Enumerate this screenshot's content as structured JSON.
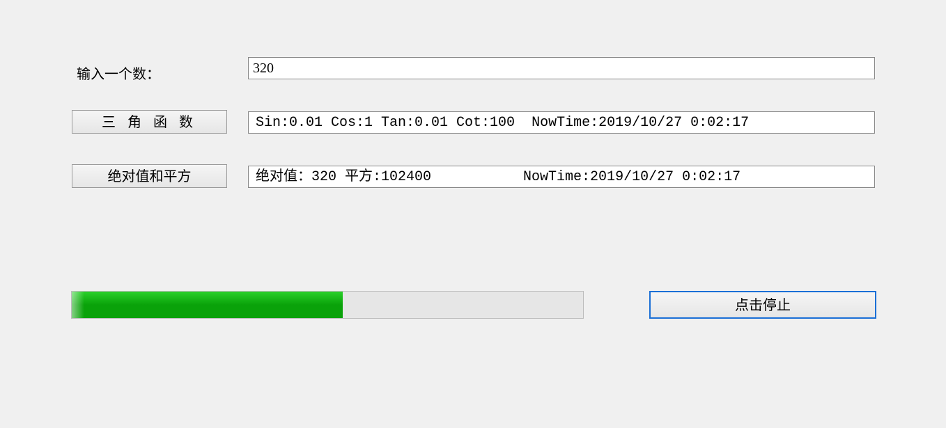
{
  "labels": {
    "input_number": "输入一个数：",
    "trig_button": "三 角 函 数",
    "abs_button": "绝对值和平方",
    "stop_button": "点击停止"
  },
  "values": {
    "input_number": "320",
    "trig_output": "Sin:0.01 Cos:1 Tan:0.01 Cot:100  NowTime:2019/10/27 0:02:17",
    "abs_output": "绝对值：320 平方:102400           NowTime:2019/10/27 0:02:17"
  },
  "progress": {
    "percent": 53
  }
}
